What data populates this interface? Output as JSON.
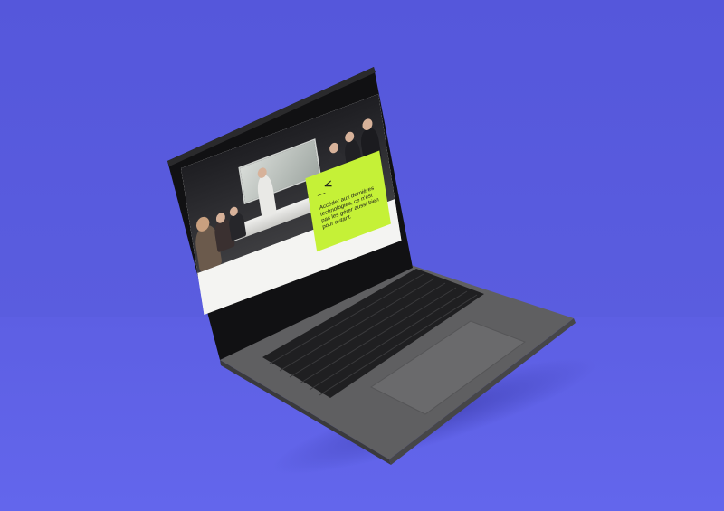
{
  "scene": {
    "background_color": "#5a5ddf",
    "device": "laptop",
    "device_color": "#5b5b5d"
  },
  "screen": {
    "callout": {
      "mark": "_<",
      "text": "Accéder aux dernières technologies, ce n'est pas les gérer aussi bien pour autant.",
      "accent_color": "#c5f137"
    },
    "photo_subject": "meeting-room-presentation"
  }
}
